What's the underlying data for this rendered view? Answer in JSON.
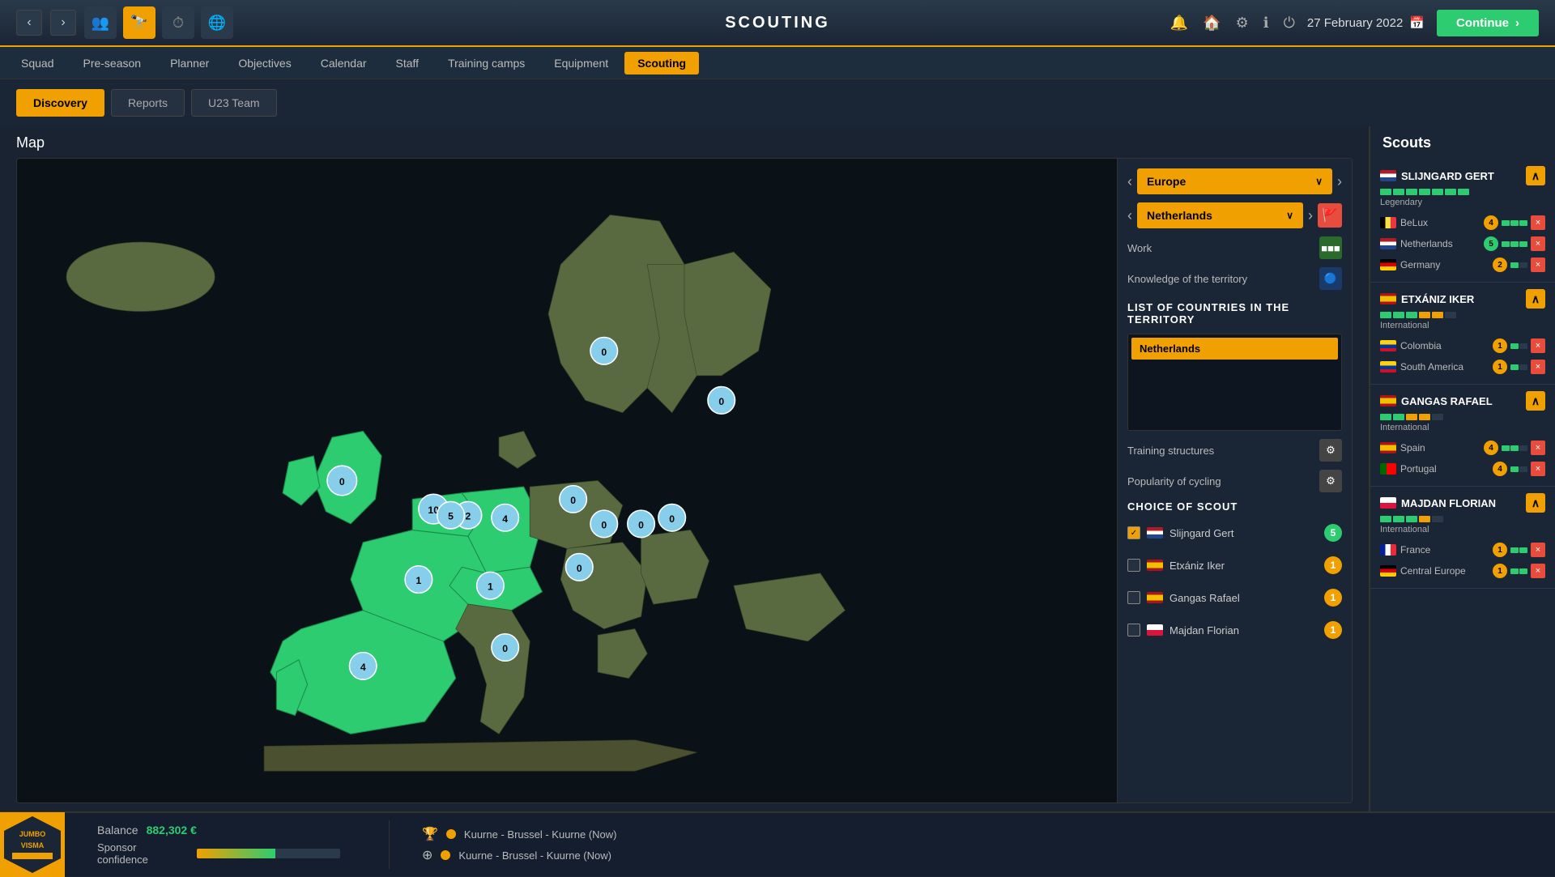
{
  "app": {
    "title": "SCOUTING",
    "date": "27 February 2022"
  },
  "topbar": {
    "back_arrow": "‹",
    "forward_arrow": "›",
    "continue_label": "Continue"
  },
  "nav_tabs": [
    {
      "label": "Squad",
      "active": false
    },
    {
      "label": "Pre-season",
      "active": false
    },
    {
      "label": "Planner",
      "active": false
    },
    {
      "label": "Objectives",
      "active": false
    },
    {
      "label": "Calendar",
      "active": false
    },
    {
      "label": "Staff",
      "active": false
    },
    {
      "label": "Training camps",
      "active": false
    },
    {
      "label": "Equipment",
      "active": false
    },
    {
      "label": "Scouting",
      "active": true
    }
  ],
  "sub_tabs": [
    {
      "label": "Discovery",
      "active": true
    },
    {
      "label": "Reports",
      "active": false
    },
    {
      "label": "U23 Team",
      "active": false
    }
  ],
  "map_section": {
    "title": "Map",
    "region_label": "Europe",
    "country_label": "Netherlands",
    "work_label": "Work",
    "knowledge_label": "Knowledge of the territory",
    "list_title": "LIST OF COUNTRIES IN THE TERRITORY",
    "countries": [
      "Netherlands"
    ],
    "training_structures_label": "Training structures",
    "popularity_label": "Popularity of cycling",
    "choice_of_scout_label": "CHOICE OF SCOUT",
    "scouts": [
      {
        "name": "Slijngard Gert",
        "flag": "nl",
        "checked": true,
        "count": 5
      },
      {
        "name": "Etxániz Iker",
        "flag": "es",
        "checked": false,
        "count": 1
      },
      {
        "name": "Gangas Rafael",
        "flag": "es",
        "checked": false,
        "count": 1
      },
      {
        "name": "Majdan Florian",
        "flag": "pl",
        "checked": false,
        "count": 1
      }
    ]
  },
  "scouts_panel": {
    "title": "Scouts",
    "scouts": [
      {
        "id": "slijngard",
        "name": "SLIJNGARD GERT",
        "flag": "nl",
        "level": "Legendary",
        "collapsed": false,
        "territories": [
          {
            "name": "BeLux",
            "flag": "be",
            "num": 4,
            "num_color": "orange"
          },
          {
            "name": "Netherlands",
            "flag": "nl",
            "num": 5,
            "num_color": "green"
          },
          {
            "name": "Germany",
            "flag": "de",
            "num": 2,
            "num_color": "orange"
          }
        ]
      },
      {
        "id": "etxaniz",
        "name": "ETXÁNIZ IKER",
        "flag": "es",
        "level": "International",
        "collapsed": false,
        "territories": [
          {
            "name": "Colombia",
            "flag": "co",
            "num": 1,
            "num_color": "orange"
          },
          {
            "name": "South America",
            "flag": "co",
            "num": 1,
            "num_color": "orange"
          }
        ]
      },
      {
        "id": "gangas",
        "name": "GANGAS RAFAEL",
        "flag": "es",
        "level": "International",
        "collapsed": false,
        "territories": [
          {
            "name": "Spain",
            "flag": "es",
            "num": 4,
            "num_color": "orange"
          },
          {
            "name": "Portugal",
            "flag": "pt",
            "num": 4,
            "num_color": "orange"
          }
        ]
      },
      {
        "id": "majdan",
        "name": "MAJDAN FLORIAN",
        "flag": "pl",
        "level": "International",
        "collapsed": false,
        "territories": [
          {
            "name": "France",
            "flag": "fr",
            "num": 1,
            "num_color": "orange"
          },
          {
            "name": "Central Europe",
            "flag": "de",
            "num": 1,
            "num_color": "orange"
          }
        ]
      }
    ]
  },
  "bottom": {
    "balance_label": "Balance",
    "balance_value": "882,302 €",
    "sponsor_label": "Sponsor confidence",
    "events": [
      {
        "icon": "🏆",
        "text": "Kuurne - Brussel - Kuurne (Now)"
      },
      {
        "icon": "⊕",
        "text": "Kuurne - Brussel - Kuurne (Now)"
      }
    ]
  }
}
